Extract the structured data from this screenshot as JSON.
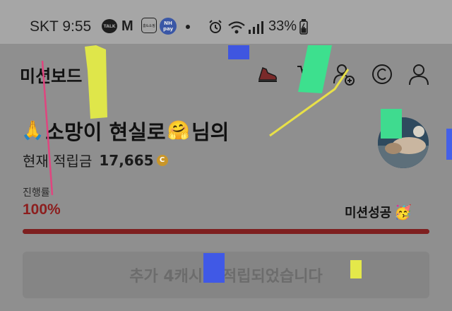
{
  "status_bar": {
    "carrier": "SKT",
    "time": "9:55",
    "talk_badge": "TALK",
    "m_badge": "M",
    "box_badge": "홈&쇼핑",
    "nh_line1": "NH",
    "nh_line2": "pay",
    "battery": "33%"
  },
  "header": {
    "title": "미션보드"
  },
  "greeting": {
    "prefix_emoji": "🙏",
    "name": "소망이 현실로",
    "name_emoji": "🤗",
    "suffix": "님의"
  },
  "balance": {
    "label": "현재 적립금",
    "amount": "17,665",
    "coin_symbol": "C"
  },
  "progress": {
    "label": "진행률",
    "value_text": "100%",
    "percent": 100,
    "status": "미션성공",
    "status_emoji": "🥳",
    "fill_color": "#7e2020"
  },
  "cta": {
    "text": "추가 4캐시가 적립되었습니다"
  },
  "colors": {
    "overlay": "#8f8f8f",
    "accent_red": "#8c1e1e"
  }
}
